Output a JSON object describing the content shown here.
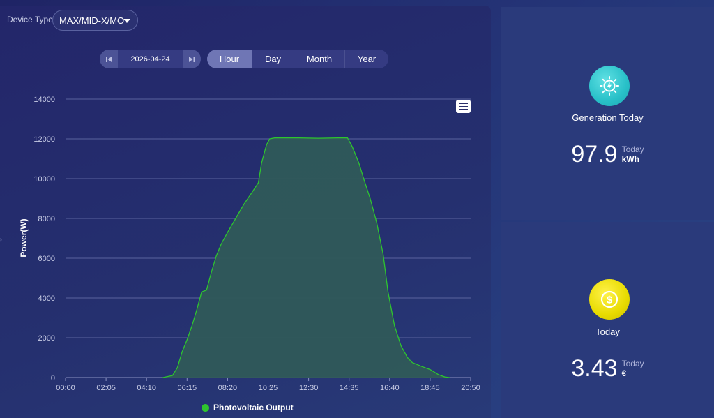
{
  "header": {
    "device_type_label": "Device Type",
    "device_type_value": "MAX/MID-X/MO"
  },
  "date_picker": {
    "date": "2026-04-24"
  },
  "period_tabs": [
    {
      "label": "Hour",
      "active": true
    },
    {
      "label": "Day",
      "active": false
    },
    {
      "label": "Month",
      "active": false
    },
    {
      "label": "Year",
      "active": false
    }
  ],
  "chart_data": {
    "type": "area",
    "ylabel": "Power(W)",
    "ylim": [
      0,
      14000
    ],
    "yticks": [
      0,
      2000,
      4000,
      6000,
      8000,
      10000,
      12000,
      14000
    ],
    "xticks": [
      "00:00",
      "02:05",
      "04:10",
      "06:15",
      "08:20",
      "10:25",
      "12:30",
      "14:35",
      "16:40",
      "18:45",
      "20:50"
    ],
    "grid": true,
    "legend_position": "bottom",
    "series": [
      {
        "name": "Photovoltaic Output",
        "color": "#2ec52e",
        "points": [
          [
            "05:00",
            0
          ],
          [
            "05:30",
            100
          ],
          [
            "05:45",
            500
          ],
          [
            "06:00",
            1300
          ],
          [
            "06:15",
            1900
          ],
          [
            "06:30",
            2600
          ],
          [
            "06:45",
            3400
          ],
          [
            "07:00",
            4300
          ],
          [
            "07:15",
            4400
          ],
          [
            "07:30",
            5300
          ],
          [
            "07:45",
            6100
          ],
          [
            "08:00",
            6700
          ],
          [
            "08:20",
            7300
          ],
          [
            "08:45",
            8000
          ],
          [
            "09:10",
            8700
          ],
          [
            "09:35",
            9300
          ],
          [
            "09:55",
            9800
          ],
          [
            "10:05",
            10800
          ],
          [
            "10:20",
            11700
          ],
          [
            "10:30",
            12000
          ],
          [
            "10:45",
            12050
          ],
          [
            "12:00",
            12050
          ],
          [
            "13:00",
            12030
          ],
          [
            "14:00",
            12050
          ],
          [
            "14:30",
            12050
          ],
          [
            "14:45",
            11600
          ],
          [
            "15:05",
            10800
          ],
          [
            "15:20",
            10000
          ],
          [
            "15:40",
            9000
          ],
          [
            "16:00",
            7800
          ],
          [
            "16:20",
            6200
          ],
          [
            "16:35",
            4300
          ],
          [
            "16:55",
            2600
          ],
          [
            "17:15",
            1600
          ],
          [
            "17:35",
            1000
          ],
          [
            "17:50",
            750
          ],
          [
            "18:20",
            550
          ],
          [
            "18:45",
            400
          ],
          [
            "19:10",
            150
          ],
          [
            "19:30",
            30
          ],
          [
            "19:45",
            0
          ]
        ]
      }
    ]
  },
  "menu_icon": "hamburger-icon",
  "cards": {
    "generation": {
      "icon": "solar-lightning-icon",
      "icon_color": "#28c0c8",
      "title": "Generation Today",
      "value": "97.9",
      "period": "Today",
      "unit": "kWh"
    },
    "earnings": {
      "icon": "dollar-coin-icon",
      "icon_color": "#e8db00",
      "title": "Today",
      "value": "3.43",
      "period": "Today",
      "unit": "€"
    }
  }
}
